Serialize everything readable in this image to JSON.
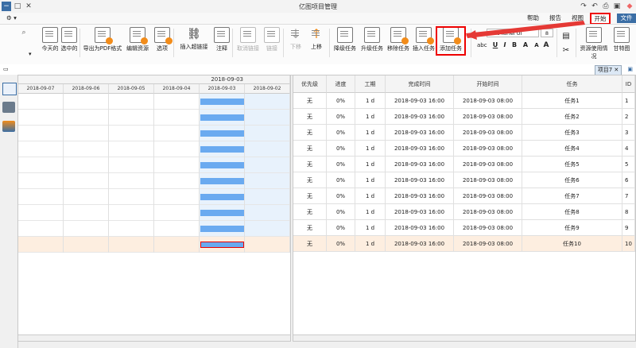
{
  "title": "亿图项目管理",
  "menu": {
    "file": "文件",
    "home": "开始",
    "view": "视图",
    "report": "报告",
    "help": "帮助"
  },
  "ribbon": {
    "buttons": [
      {
        "id": "gantt-chart",
        "label": "甘特图"
      },
      {
        "id": "resource-usage",
        "label": "资源使用情况"
      },
      {
        "id": "add-task",
        "label": "添加任务"
      },
      {
        "id": "insert-task",
        "label": "插入任务"
      },
      {
        "id": "remove-task",
        "label": "移除任务"
      },
      {
        "id": "raise-task",
        "label": "升级任务"
      },
      {
        "id": "lower-task",
        "label": "降级任务"
      },
      {
        "id": "move-up",
        "label": "上移"
      },
      {
        "id": "move-down",
        "label": "下移"
      },
      {
        "id": "link",
        "label": "链接"
      },
      {
        "id": "unlink",
        "label": "取消链接"
      },
      {
        "id": "note",
        "label": "注释"
      },
      {
        "id": "insert-hyperlink",
        "label": "插入超链接"
      },
      {
        "id": "options",
        "label": "选项"
      },
      {
        "id": "edit-resources",
        "label": "编辑资源"
      },
      {
        "id": "export-pdf",
        "label": "导出为PDF格式"
      },
      {
        "id": "select-all",
        "label": "选中的"
      },
      {
        "id": "today",
        "label": "今天的"
      }
    ],
    "font_name": "Soft YaHei UI",
    "font_size": "8"
  },
  "doc_tab": {
    "label": "项目7"
  },
  "gantt": {
    "top_header": "2018-09-03",
    "date_headers": [
      "2018-09-02",
      "2018-09-03",
      "2018-09-04",
      "2018-09-05",
      "2018-09-06",
      "2018-09-07"
    ]
  },
  "table": {
    "headers": [
      "ID",
      "任务",
      "开始时间",
      "完成时间",
      "工期",
      "进度",
      "优先级"
    ],
    "rows": [
      {
        "id": "1",
        "task": "任务1",
        "start": "2018-09-03 08:00",
        "finish": "2018-09-03 16:00",
        "duration": "1 d",
        "progress": "0%",
        "priority": "无"
      },
      {
        "id": "2",
        "task": "任务2",
        "start": "2018-09-03 08:00",
        "finish": "2018-09-03 16:00",
        "duration": "1 d",
        "progress": "0%",
        "priority": "无"
      },
      {
        "id": "3",
        "task": "任务3",
        "start": "2018-09-03 08:00",
        "finish": "2018-09-03 16:00",
        "duration": "1 d",
        "progress": "0%",
        "priority": "无"
      },
      {
        "id": "4",
        "task": "任务4",
        "start": "2018-09-03 08:00",
        "finish": "2018-09-03 16:00",
        "duration": "1 d",
        "progress": "0%",
        "priority": "无"
      },
      {
        "id": "5",
        "task": "任务5",
        "start": "2018-09-03 08:00",
        "finish": "2018-09-03 16:00",
        "duration": "1 d",
        "progress": "0%",
        "priority": "无"
      },
      {
        "id": "6",
        "task": "任务6",
        "start": "2018-09-03 08:00",
        "finish": "2018-09-03 16:00",
        "duration": "1 d",
        "progress": "0%",
        "priority": "无"
      },
      {
        "id": "7",
        "task": "任务7",
        "start": "2018-09-03 08:00",
        "finish": "2018-09-03 16:00",
        "duration": "1 d",
        "progress": "0%",
        "priority": "无"
      },
      {
        "id": "8",
        "task": "任务8",
        "start": "2018-09-03 08:00",
        "finish": "2018-09-03 16:00",
        "duration": "1 d",
        "progress": "0%",
        "priority": "无"
      },
      {
        "id": "9",
        "task": "任务9",
        "start": "2018-09-03 08:00",
        "finish": "2018-09-03 16:00",
        "duration": "1 d",
        "progress": "0%",
        "priority": "无"
      },
      {
        "id": "10",
        "task": "任务10",
        "start": "2018-09-03 08:00",
        "finish": "2018-09-03 16:00",
        "duration": "1 d",
        "progress": "0%",
        "priority": "无"
      }
    ]
  },
  "colors": {
    "accent": "#3b6ea5",
    "bar": "#6aaaf0",
    "highlight": "#e00000",
    "selected_row": "#fdeee0"
  }
}
